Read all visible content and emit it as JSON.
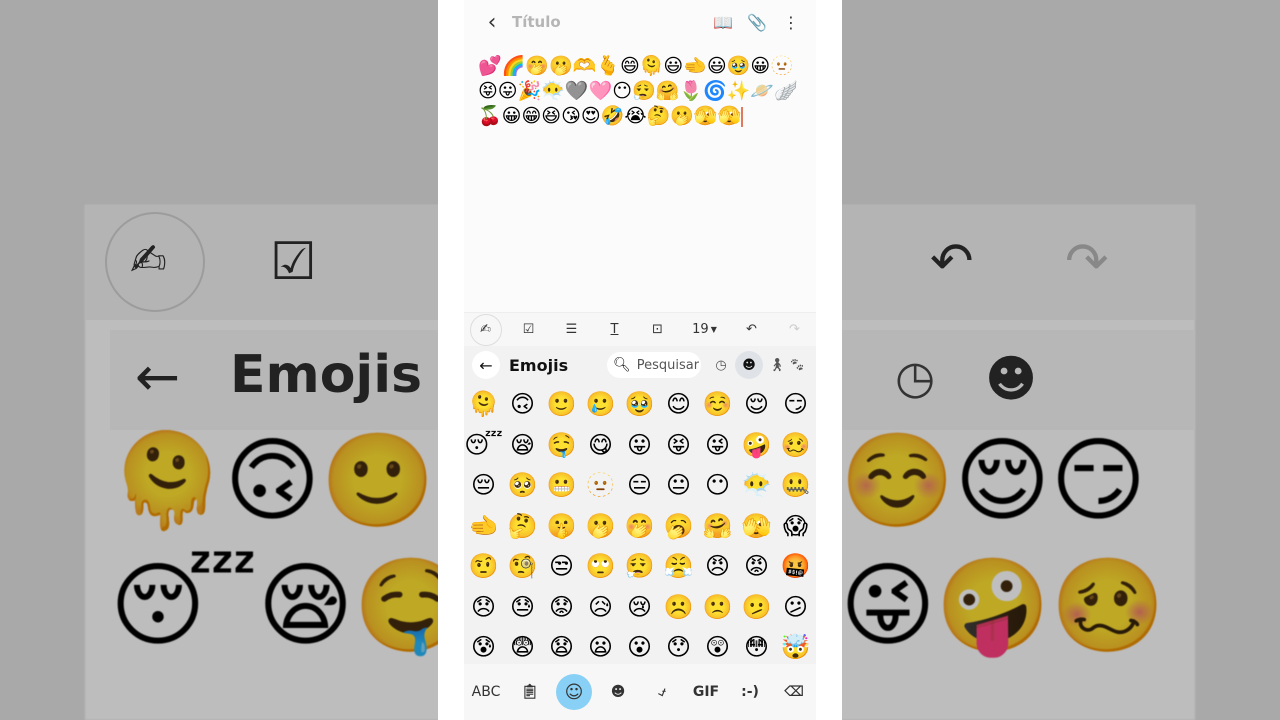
{
  "background": {
    "title": "Emojis"
  },
  "note": {
    "title": "Título",
    "content": "💕🌈🤭🫢🫶🫰😄🫠😃🫲😃🥹😀🫥😝😛🎉😶‍🌫️🩶🩷😶😮‍💨🤗🌷🌀✨🪐🪽🍒😀😁😆😘😍🤣😭🤔🫢🫣🫣"
  },
  "toolbar": {
    "font_size": "19"
  },
  "keyboard": {
    "header_title": "Emojis",
    "search_placeholder": "Pesquisar",
    "emoji_rows": [
      [
        "🫠",
        "🙃",
        "🙂",
        "🥲",
        "🥹",
        "😊",
        "☺️",
        "😌",
        "😏"
      ],
      [
        "😴",
        "😪",
        "🤤",
        "😋",
        "😛",
        "😝",
        "😜",
        "🤪",
        "🥴"
      ],
      [
        "😔",
        "🥺",
        "😬",
        "🫥",
        "😑",
        "😐",
        "😶",
        "😶‍🌫️",
        "🤐"
      ],
      [
        "🫲",
        "🤔",
        "🤫",
        "🫢",
        "🤭",
        "🥱",
        "🤗",
        "🫣",
        "😱"
      ],
      [
        "🤨",
        "🧐",
        "😒",
        "🙄",
        "😮‍💨",
        "😤",
        "😠",
        "😡",
        "🤬"
      ],
      [
        "😞",
        "😓",
        "😟",
        "😥",
        "😢",
        "☹️",
        "🙁",
        "🫤",
        "😕"
      ],
      [
        "😰",
        "😨",
        "😧",
        "😦",
        "😮",
        "😯",
        "😲",
        "😳",
        "🤯"
      ]
    ],
    "bottom_bar": {
      "abc": "ABC",
      "gif": "GIF",
      "emoticon": ":-)"
    }
  }
}
